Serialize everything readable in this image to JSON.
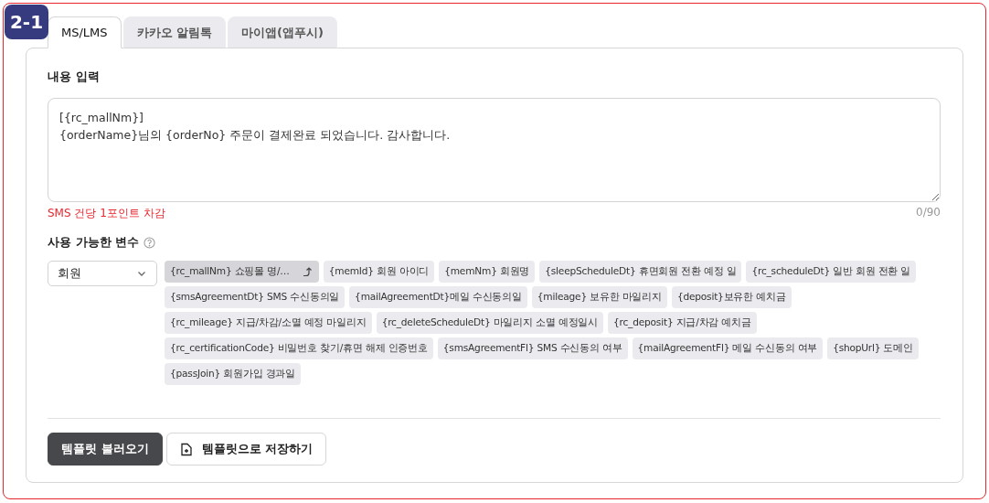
{
  "badge": "2-1",
  "tabs": [
    {
      "label": "MS/LMS",
      "selected": true
    },
    {
      "label": "카카오 알림톡",
      "selected": false
    },
    {
      "label": "마이앱(앱푸시)",
      "selected": false
    }
  ],
  "content": {
    "label": "내용 입력",
    "value": "[{rc_mallNm}]\n{orderName}님의 {orderNo} 주문이 결제완료 되었습니다. 감사합니다.",
    "note": "SMS 건당 1포인트 차감",
    "counter": "0/90"
  },
  "variables": {
    "label": "사용 가능한 변수",
    "category": "회원",
    "chips": [
      {
        "label": "{rc_mallNm} 쇼핑몰 명/…",
        "selected": true
      },
      {
        "label": "{memId} 회원 아이디",
        "selected": false
      },
      {
        "label": "{memNm} 회원명",
        "selected": false
      },
      {
        "label": "{sleepScheduleDt} 휴면회원 전환 예정 일",
        "selected": false
      },
      {
        "label": "{rc_scheduleDt} 일반 회원 전환 일",
        "selected": false
      },
      {
        "label": "{smsAgreementDt} SMS 수신동의일",
        "selected": false
      },
      {
        "label": "{mailAgreementDt}메일 수신동의일",
        "selected": false
      },
      {
        "label": "{mileage} 보유한 마일리지",
        "selected": false
      },
      {
        "label": "{deposit}보유한 예치금",
        "selected": false
      },
      {
        "label": "{rc_mileage} 지급/차감/소멸 예정 마일리지",
        "selected": false
      },
      {
        "label": "{rc_deleteScheduleDt} 마일리지 소멸 예정일시",
        "selected": false
      },
      {
        "label": "{rc_deposit} 지급/차감 예치금",
        "selected": false
      },
      {
        "label": "{rc_certificationCode} 비밀번호 찾기/휴면 해제 인증번호",
        "selected": false
      },
      {
        "label": "{smsAgreementFl} SMS 수신동의 여부",
        "selected": false
      },
      {
        "label": "{mailAgreementFl} 메일 수신동의 여부",
        "selected": false
      },
      {
        "label": "{shopUrl} 도메인",
        "selected": false
      },
      {
        "label": "{passJoin} 회원가입 경과일",
        "selected": false
      }
    ]
  },
  "buttons": [
    {
      "label": "템플릿 불러오기",
      "kind": "primary"
    },
    {
      "label": "템플릿으로 저장하기",
      "kind": "secondary"
    }
  ]
}
